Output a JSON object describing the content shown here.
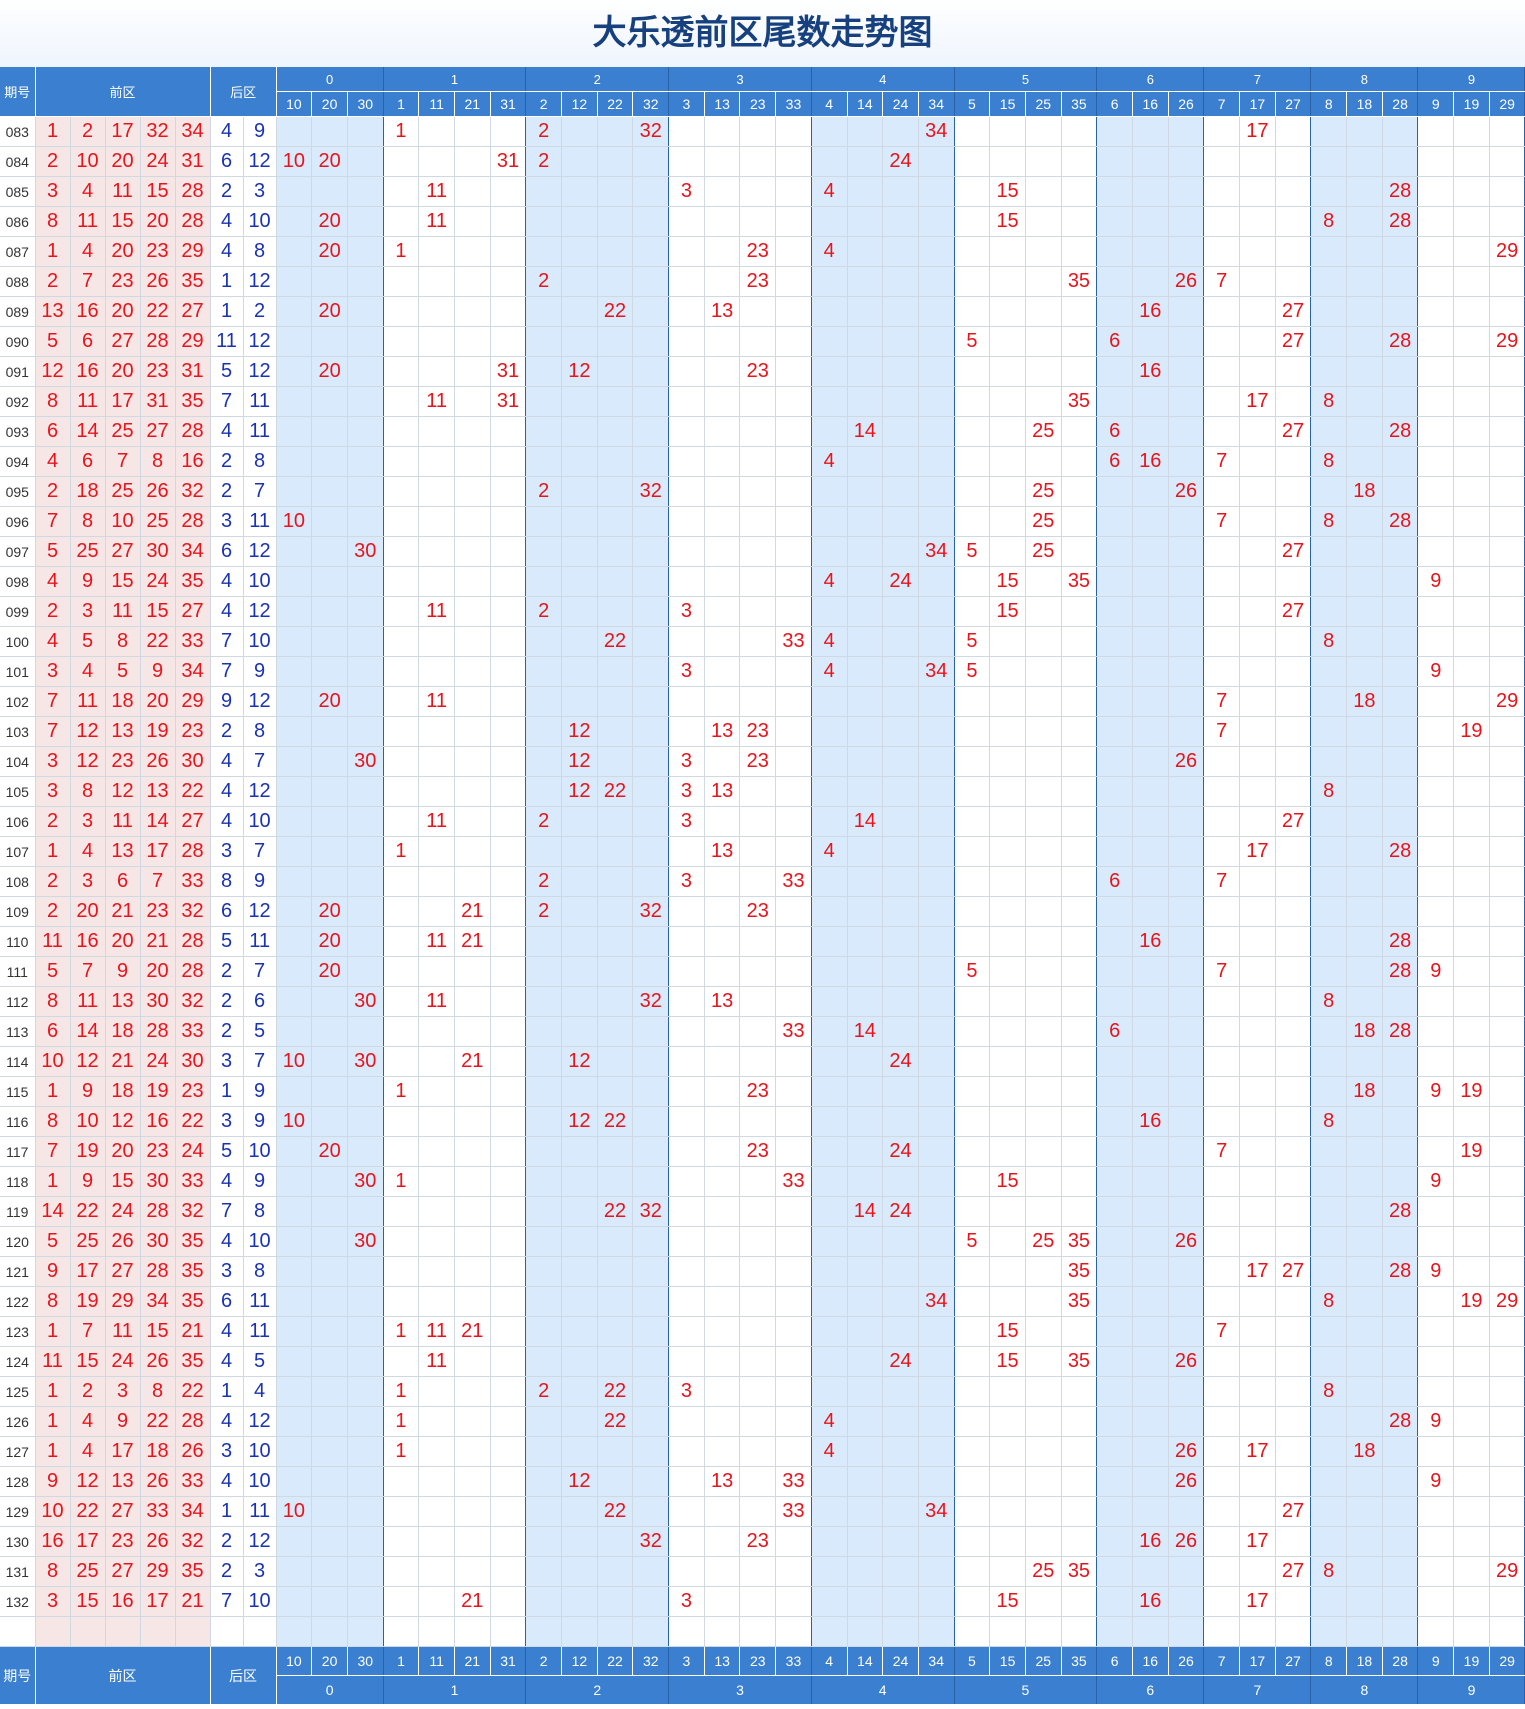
{
  "title": "大乐透前区尾数走势图",
  "header": {
    "period": "期号",
    "front": "前区",
    "back": "后区"
  },
  "groups": [
    {
      "label": "0",
      "nums": [
        "10",
        "20",
        "30"
      ]
    },
    {
      "label": "1",
      "nums": [
        "1",
        "11",
        "21",
        "31"
      ]
    },
    {
      "label": "2",
      "nums": [
        "2",
        "12",
        "22",
        "32"
      ]
    },
    {
      "label": "3",
      "nums": [
        "3",
        "13",
        "23",
        "33"
      ]
    },
    {
      "label": "4",
      "nums": [
        "4",
        "14",
        "24",
        "34"
      ]
    },
    {
      "label": "5",
      "nums": [
        "5",
        "15",
        "25",
        "35"
      ]
    },
    {
      "label": "6",
      "nums": [
        "6",
        "16",
        "26"
      ]
    },
    {
      "label": "7",
      "nums": [
        "7",
        "17",
        "27"
      ]
    },
    {
      "label": "8",
      "nums": [
        "8",
        "18",
        "28"
      ]
    },
    {
      "label": "9",
      "nums": [
        "9",
        "19",
        "29"
      ]
    }
  ],
  "colors": {
    "header_bg": "#3a7fd0",
    "title": "#17407f",
    "front_text": "#e8141c",
    "back_text": "#1a33b3",
    "shade": "#d8eafb",
    "front_bg": "#f7e6e6"
  },
  "rows": [
    {
      "p": "083",
      "f": [
        "1",
        "2",
        "17",
        "32",
        "34"
      ],
      "b": [
        "4",
        "9"
      ]
    },
    {
      "p": "084",
      "f": [
        "2",
        "10",
        "20",
        "24",
        "31"
      ],
      "b": [
        "6",
        "12"
      ]
    },
    {
      "p": "085",
      "f": [
        "3",
        "4",
        "11",
        "15",
        "28"
      ],
      "b": [
        "2",
        "3"
      ]
    },
    {
      "p": "086",
      "f": [
        "8",
        "11",
        "15",
        "20",
        "28"
      ],
      "b": [
        "4",
        "10"
      ]
    },
    {
      "p": "087",
      "f": [
        "1",
        "4",
        "20",
        "23",
        "29"
      ],
      "b": [
        "4",
        "8"
      ]
    },
    {
      "p": "088",
      "f": [
        "2",
        "7",
        "23",
        "26",
        "35"
      ],
      "b": [
        "1",
        "12"
      ]
    },
    {
      "p": "089",
      "f": [
        "13",
        "16",
        "20",
        "22",
        "27"
      ],
      "b": [
        "1",
        "2"
      ]
    },
    {
      "p": "090",
      "f": [
        "5",
        "6",
        "27",
        "28",
        "29"
      ],
      "b": [
        "11",
        "12"
      ]
    },
    {
      "p": "091",
      "f": [
        "12",
        "16",
        "20",
        "23",
        "31"
      ],
      "b": [
        "5",
        "12"
      ]
    },
    {
      "p": "092",
      "f": [
        "8",
        "11",
        "17",
        "31",
        "35"
      ],
      "b": [
        "7",
        "11"
      ]
    },
    {
      "p": "093",
      "f": [
        "6",
        "14",
        "25",
        "27",
        "28"
      ],
      "b": [
        "4",
        "11"
      ]
    },
    {
      "p": "094",
      "f": [
        "4",
        "6",
        "7",
        "8",
        "16"
      ],
      "b": [
        "2",
        "8"
      ]
    },
    {
      "p": "095",
      "f": [
        "2",
        "18",
        "25",
        "26",
        "32"
      ],
      "b": [
        "2",
        "7"
      ]
    },
    {
      "p": "096",
      "f": [
        "7",
        "8",
        "10",
        "25",
        "28"
      ],
      "b": [
        "3",
        "11"
      ]
    },
    {
      "p": "097",
      "f": [
        "5",
        "25",
        "27",
        "30",
        "34"
      ],
      "b": [
        "6",
        "12"
      ]
    },
    {
      "p": "098",
      "f": [
        "4",
        "9",
        "15",
        "24",
        "35"
      ],
      "b": [
        "4",
        "10"
      ]
    },
    {
      "p": "099",
      "f": [
        "2",
        "3",
        "11",
        "15",
        "27"
      ],
      "b": [
        "4",
        "12"
      ]
    },
    {
      "p": "100",
      "f": [
        "4",
        "5",
        "8",
        "22",
        "33"
      ],
      "b": [
        "7",
        "10"
      ]
    },
    {
      "p": "101",
      "f": [
        "3",
        "4",
        "5",
        "9",
        "34"
      ],
      "b": [
        "7",
        "9"
      ]
    },
    {
      "p": "102",
      "f": [
        "7",
        "11",
        "18",
        "20",
        "29"
      ],
      "b": [
        "9",
        "12"
      ]
    },
    {
      "p": "103",
      "f": [
        "7",
        "12",
        "13",
        "19",
        "23"
      ],
      "b": [
        "2",
        "8"
      ]
    },
    {
      "p": "104",
      "f": [
        "3",
        "12",
        "23",
        "26",
        "30"
      ],
      "b": [
        "4",
        "7"
      ]
    },
    {
      "p": "105",
      "f": [
        "3",
        "8",
        "12",
        "13",
        "22"
      ],
      "b": [
        "4",
        "12"
      ]
    },
    {
      "p": "106",
      "f": [
        "2",
        "3",
        "11",
        "14",
        "27"
      ],
      "b": [
        "4",
        "10"
      ]
    },
    {
      "p": "107",
      "f": [
        "1",
        "4",
        "13",
        "17",
        "28"
      ],
      "b": [
        "3",
        "7"
      ]
    },
    {
      "p": "108",
      "f": [
        "2",
        "3",
        "6",
        "7",
        "33"
      ],
      "b": [
        "8",
        "9"
      ]
    },
    {
      "p": "109",
      "f": [
        "2",
        "20",
        "21",
        "23",
        "32"
      ],
      "b": [
        "6",
        "12"
      ]
    },
    {
      "p": "110",
      "f": [
        "11",
        "16",
        "20",
        "21",
        "28"
      ],
      "b": [
        "5",
        "11"
      ]
    },
    {
      "p": "111",
      "f": [
        "5",
        "7",
        "9",
        "20",
        "28"
      ],
      "b": [
        "2",
        "7"
      ]
    },
    {
      "p": "112",
      "f": [
        "8",
        "11",
        "13",
        "30",
        "32"
      ],
      "b": [
        "2",
        "6"
      ]
    },
    {
      "p": "113",
      "f": [
        "6",
        "14",
        "18",
        "28",
        "33"
      ],
      "b": [
        "2",
        "5"
      ]
    },
    {
      "p": "114",
      "f": [
        "10",
        "12",
        "21",
        "24",
        "30"
      ],
      "b": [
        "3",
        "7"
      ]
    },
    {
      "p": "115",
      "f": [
        "1",
        "9",
        "18",
        "19",
        "23"
      ],
      "b": [
        "1",
        "9"
      ]
    },
    {
      "p": "116",
      "f": [
        "8",
        "10",
        "12",
        "16",
        "22"
      ],
      "b": [
        "3",
        "9"
      ]
    },
    {
      "p": "117",
      "f": [
        "7",
        "19",
        "20",
        "23",
        "24"
      ],
      "b": [
        "5",
        "10"
      ]
    },
    {
      "p": "118",
      "f": [
        "1",
        "9",
        "15",
        "30",
        "33"
      ],
      "b": [
        "4",
        "9"
      ]
    },
    {
      "p": "119",
      "f": [
        "14",
        "22",
        "24",
        "28",
        "32"
      ],
      "b": [
        "7",
        "8"
      ]
    },
    {
      "p": "120",
      "f": [
        "5",
        "25",
        "26",
        "30",
        "35"
      ],
      "b": [
        "4",
        "10"
      ]
    },
    {
      "p": "121",
      "f": [
        "9",
        "17",
        "27",
        "28",
        "35"
      ],
      "b": [
        "3",
        "8"
      ]
    },
    {
      "p": "122",
      "f": [
        "8",
        "19",
        "29",
        "34",
        "35"
      ],
      "b": [
        "6",
        "11"
      ]
    },
    {
      "p": "123",
      "f": [
        "1",
        "7",
        "11",
        "15",
        "21"
      ],
      "b": [
        "4",
        "11"
      ]
    },
    {
      "p": "124",
      "f": [
        "11",
        "15",
        "24",
        "26",
        "35"
      ],
      "b": [
        "4",
        "5"
      ]
    },
    {
      "p": "125",
      "f": [
        "1",
        "2",
        "3",
        "8",
        "22"
      ],
      "b": [
        "1",
        "4"
      ]
    },
    {
      "p": "126",
      "f": [
        "1",
        "4",
        "9",
        "22",
        "28"
      ],
      "b": [
        "4",
        "12"
      ]
    },
    {
      "p": "127",
      "f": [
        "1",
        "4",
        "17",
        "18",
        "26"
      ],
      "b": [
        "3",
        "10"
      ]
    },
    {
      "p": "128",
      "f": [
        "9",
        "12",
        "13",
        "26",
        "33"
      ],
      "b": [
        "4",
        "10"
      ]
    },
    {
      "p": "129",
      "f": [
        "10",
        "22",
        "27",
        "33",
        "34"
      ],
      "b": [
        "1",
        "11"
      ]
    },
    {
      "p": "130",
      "f": [
        "16",
        "17",
        "23",
        "26",
        "32"
      ],
      "b": [
        "2",
        "12"
      ]
    },
    {
      "p": "131",
      "f": [
        "8",
        "25",
        "27",
        "29",
        "35"
      ],
      "b": [
        "2",
        "3"
      ]
    },
    {
      "p": "132",
      "f": [
        "3",
        "15",
        "16",
        "17",
        "21"
      ],
      "b": [
        "7",
        "10"
      ]
    }
  ]
}
